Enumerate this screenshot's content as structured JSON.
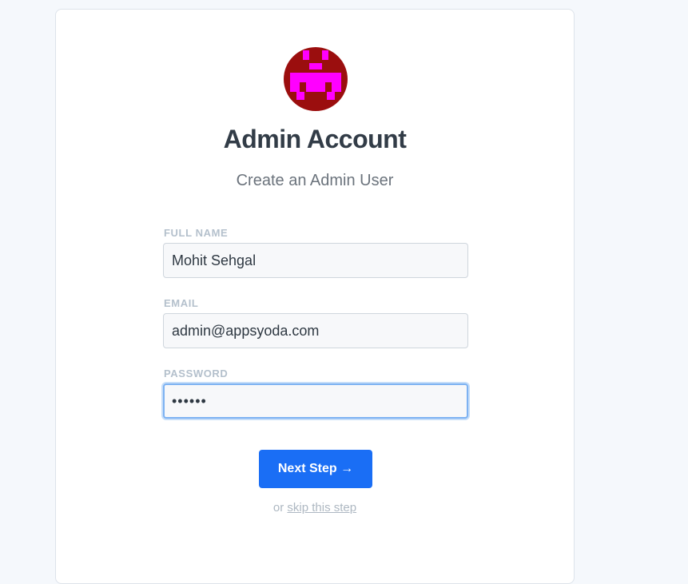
{
  "colors": {
    "page_background": "#f5f8fc",
    "card_background": "#ffffff",
    "avatar_background": "#9b0e0e",
    "avatar_pixels": "#ff00ff",
    "primary_button": "#1a6ef5",
    "focus_ring": "#7db2f2"
  },
  "header": {
    "avatar_icon": "pixel-invader-icon",
    "title": "Admin Account",
    "subtitle": "Create an Admin User"
  },
  "form": {
    "full_name": {
      "label": "FULL NAME",
      "value": "Mohit Sehgal"
    },
    "email": {
      "label": "EMAIL",
      "value": "admin@appsyoda.com"
    },
    "password": {
      "label": "PASSWORD",
      "value": "••••••",
      "focused": true
    }
  },
  "actions": {
    "next_label": "Next Step →",
    "or_text": "or",
    "skip_label": "skip this step"
  }
}
